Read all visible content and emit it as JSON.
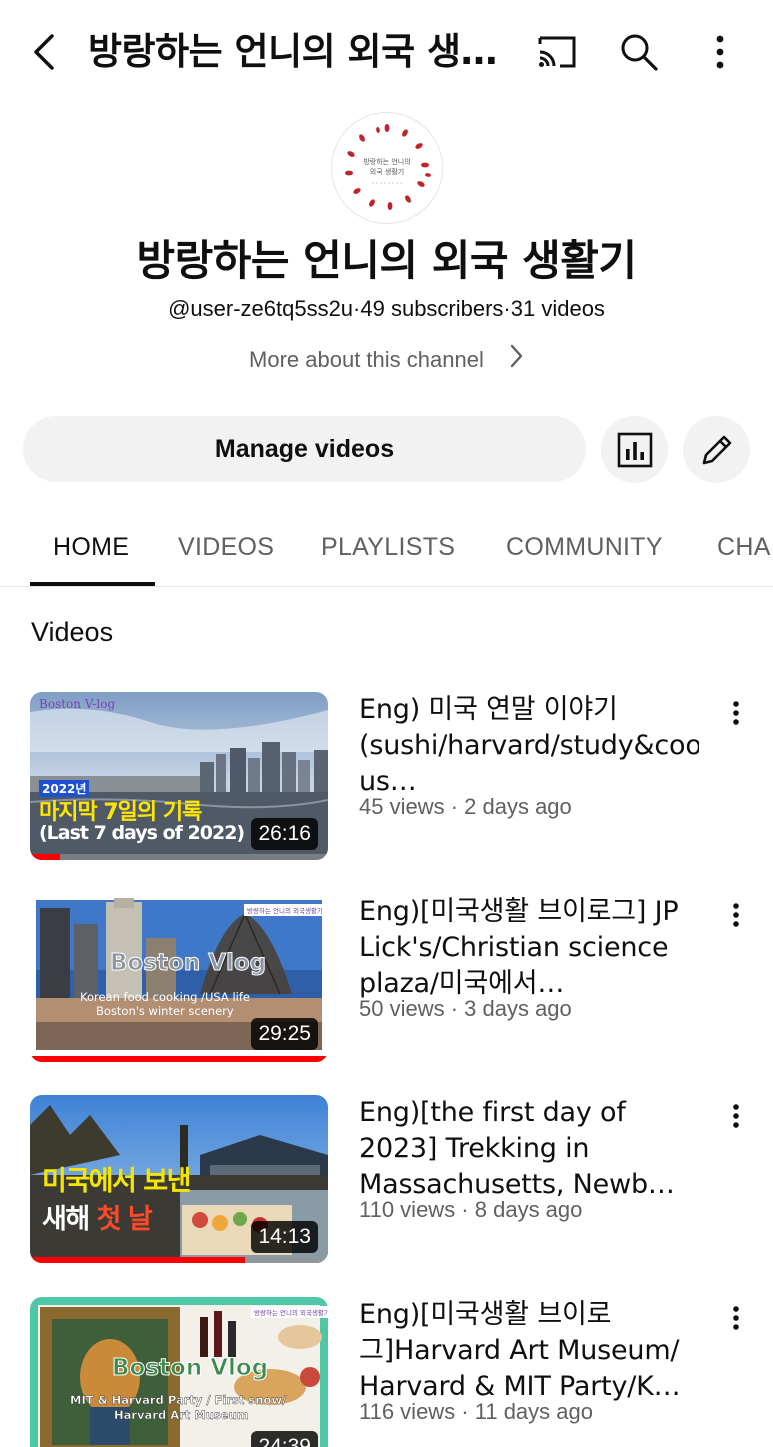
{
  "appbar": {
    "title": "방랑하는 언니의 외국 생…",
    "icons": [
      "back-arrow-icon",
      "cast-icon",
      "search-icon",
      "more-vertical-icon"
    ]
  },
  "channel": {
    "avatar_text_line1": "방랑하는 언니의",
    "avatar_text_line2": "외국 생활기",
    "name": "방랑하는 언니의 외국 생활기",
    "meta": "@user-ze6tq5ss2u·49 subscribers·31 videos",
    "more_about": "More about this channel"
  },
  "actions": {
    "manage_label": "Manage videos"
  },
  "tabs": [
    {
      "label": "HOME"
    },
    {
      "label": "VIDEOS"
    },
    {
      "label": "PLAYLISTS"
    },
    {
      "label": "COMMUNITY"
    },
    {
      "label": "CHA"
    }
  ],
  "section": {
    "title": "Videos"
  },
  "videos": [
    {
      "title": "Eng) 미국 연말 이야기 (sushi/harvard/study&cook/Reven us…",
      "meta": "45 views · 2 days ago",
      "duration": "26:16",
      "progress": 0.1,
      "thumb_tag": "Boston V-log",
      "thumb_year": "2022년",
      "thumb_line1": "마지막 7일의 기록",
      "thumb_line2": "(Last 7 days of 2022)"
    },
    {
      "title": "Eng)[미국생활 브이로그] JP Lick's/Christian science plaza/미국에서…",
      "meta": "50 views · 3 days ago",
      "duration": "29:25",
      "progress": 1.0,
      "thumb_tag": "방랑하는 언니의 외국생활기",
      "thumb_line1": "Boston Vlog",
      "thumb_line2": "Korean food cooking /USA life",
      "thumb_line3": "Boston's winter scenery"
    },
    {
      "title": "Eng)[the first day of 2023] Trekking in Massachusetts, Newb…",
      "meta": "110 views · 8 days ago",
      "duration": "14:13",
      "progress": 0.72,
      "thumb_line1": "미국에서 보낸",
      "thumb_line2a": "새해",
      "thumb_line2b": "첫 날"
    },
    {
      "title": "Eng)[미국생활 브이로그]Harvard Art Museum/ Harvard & MIT Party/K…",
      "meta": "116 views · 11 days ago",
      "duration": "24:39",
      "progress": 0,
      "thumb_tag": "방랑하는 언니의 외국생활기",
      "thumb_line1": "Boston Vlog",
      "thumb_line2": "MIT & Harvard Party / First snow/",
      "thumb_line3": "Harvard Art Museum"
    }
  ],
  "colors": {
    "progress": "#ff0000",
    "text_primary": "#0f0f0f",
    "text_secondary": "#606060",
    "chip_bg": "#f2f2f2"
  }
}
